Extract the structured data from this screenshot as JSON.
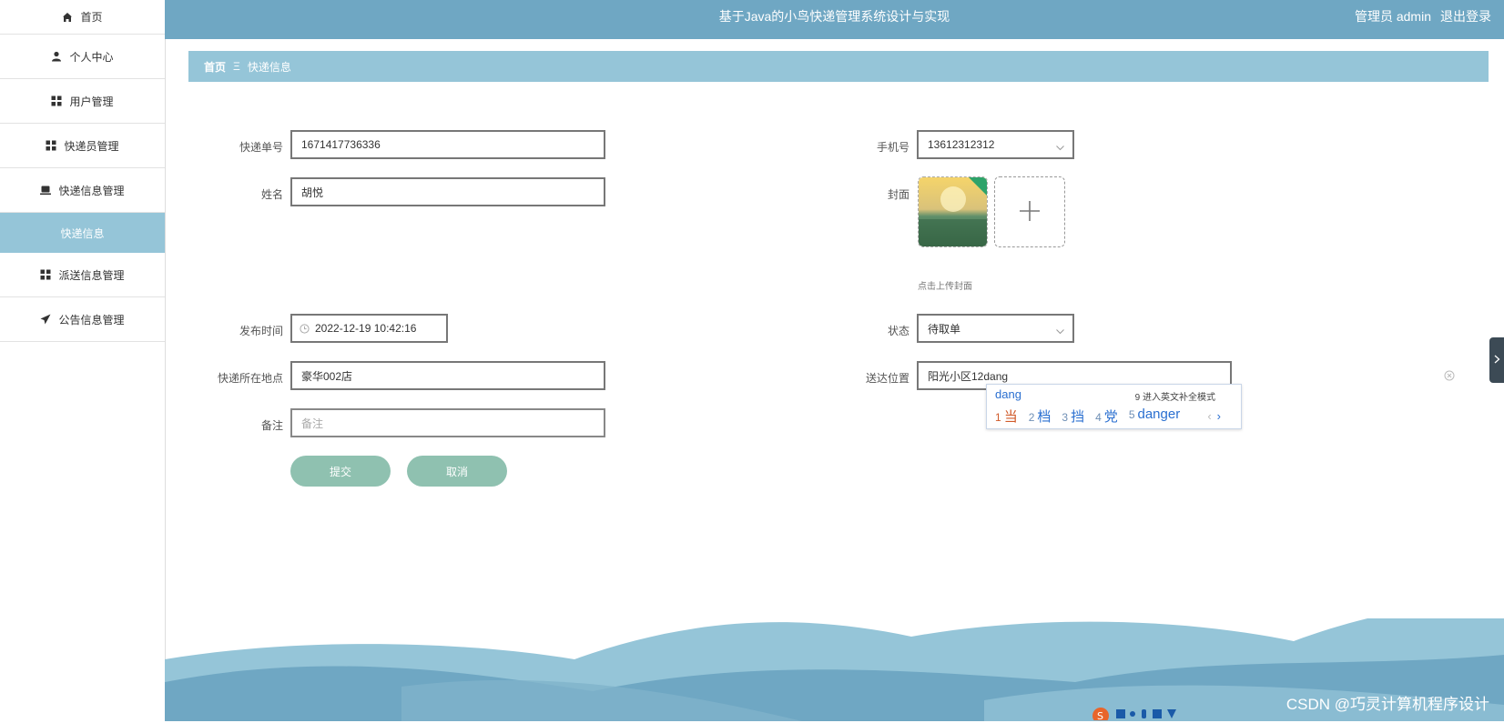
{
  "sidebar": {
    "items": [
      {
        "label": "首页",
        "icon": "home-icon"
      },
      {
        "label": "个人中心",
        "icon": "user-icon"
      },
      {
        "label": "用户管理",
        "icon": "grid-icon"
      },
      {
        "label": "快递员管理",
        "icon": "grid-icon"
      },
      {
        "label": "快递信息管理",
        "icon": "laptop-icon"
      },
      {
        "label": "快递信息",
        "icon": "",
        "active": true
      },
      {
        "label": "派送信息管理",
        "icon": "grid-icon"
      },
      {
        "label": "公告信息管理",
        "icon": "send-icon"
      }
    ]
  },
  "header": {
    "title": "基于Java的小鸟快递管理系统设计与实现",
    "user": "管理员 admin",
    "logout": "退出登录"
  },
  "breadcrumb": {
    "home": "首页",
    "separator": "Ξ",
    "current": "快递信息"
  },
  "form": {
    "tracking_no": {
      "label": "快递单号",
      "value": "1671417736336"
    },
    "name": {
      "label": "姓名",
      "value": "胡悦"
    },
    "phone": {
      "label": "手机号",
      "value": "13612312312"
    },
    "cover": {
      "label": "封面",
      "hint": "点击上传封面"
    },
    "publish_time": {
      "label": "发布时间",
      "value": "2022-12-19 10:42:16"
    },
    "status": {
      "label": "状态",
      "value": "待取单"
    },
    "location": {
      "label": "快递所在地点",
      "value": "豪华002店"
    },
    "delivery": {
      "label": "送达位置",
      "value": "阳光小区12dang"
    },
    "remark": {
      "label": "备注",
      "placeholder": "备注"
    },
    "submit": "提交",
    "cancel": "取消"
  },
  "ime": {
    "input": "dang",
    "mode": "9 进入英文补全模式",
    "candidates": [
      {
        "num": "1",
        "text": "当"
      },
      {
        "num": "2",
        "text": "档"
      },
      {
        "num": "3",
        "text": "挡"
      },
      {
        "num": "4",
        "text": "党"
      },
      {
        "num": "5",
        "text": "danger"
      }
    ],
    "prev": "‹",
    "next": "›"
  },
  "watermark": "CSDN @巧灵计算机程序设计",
  "colors": {
    "header": "#6fa7c3",
    "breadcrumb": "#95c5d8",
    "button": "#8fc1b0",
    "active": "#95c5d8"
  }
}
